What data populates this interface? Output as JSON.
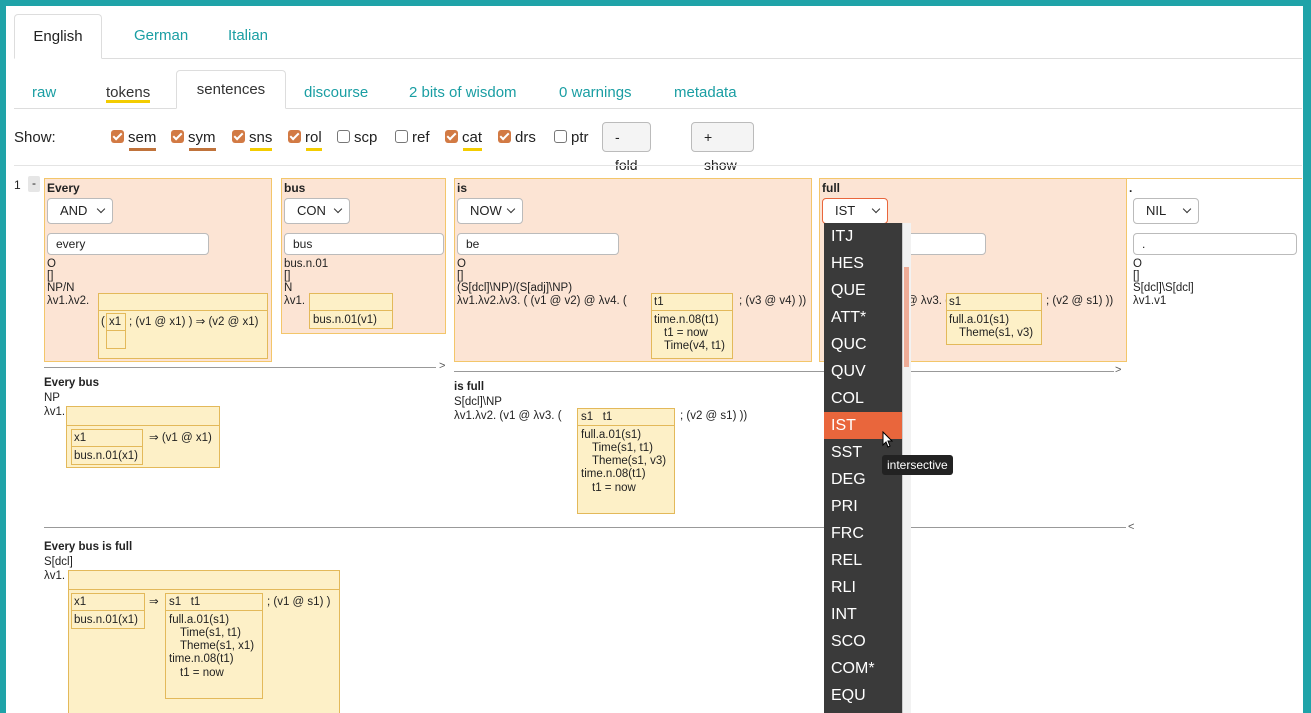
{
  "lang_tabs": [
    "English",
    "German",
    "Italian"
  ],
  "sub_tabs": [
    "raw",
    "tokens",
    "sentences",
    "discourse",
    "2 bits of wisdom",
    "0 warnings",
    "metadata"
  ],
  "show": {
    "label": "Show:",
    "layers": [
      {
        "name": "sem",
        "checked": true,
        "underline": "#c0733b"
      },
      {
        "name": "sym",
        "checked": true,
        "underline": "#c0733b"
      },
      {
        "name": "sns",
        "checked": true,
        "underline": "#f3cc00"
      },
      {
        "name": "rol",
        "checked": true,
        "underline": "#f3cc00"
      },
      {
        "name": "scp",
        "checked": false
      },
      {
        "name": "ref",
        "checked": false
      },
      {
        "name": "cat",
        "checked": true,
        "underline": "#f3cc00"
      },
      {
        "name": "drs",
        "checked": true
      },
      {
        "name": "ptr",
        "checked": false
      }
    ],
    "fold_all": "- fold all",
    "show_all": "+ show all layers"
  },
  "sentence_number": "1",
  "fold_marker": "-",
  "tokens": [
    {
      "word": "Every",
      "tag": "AND",
      "lemma": "every",
      "sym_o": "O",
      "brackets": "[]",
      "cat": "NP/N",
      "lambda": "λv1.λv2.",
      "drs_cond": "( x1 ; (v1 @ x1) ) ⇒ (v2 @ x1)",
      "drs_ref": "x1"
    },
    {
      "word": "bus",
      "tag": "CON",
      "lemma": "bus",
      "sense": "bus.n.01",
      "brackets": "[]",
      "cat": "N",
      "lambda": "λv1.",
      "cond": "bus.n.01(v1)"
    },
    {
      "word": "is",
      "tag": "NOW",
      "lemma": "be",
      "sym_o": "O",
      "brackets": "[]",
      "cat": "(S[dcl]\\NP)/(S[adj]\\NP)",
      "lambda": "λv1.λv2.λv3. ( (v1 @ v2) @ λv4. (",
      "ref": "t1",
      "after": "; (v3 @ v4) ))",
      "conds": [
        "time.n.08(t1)",
        "t1 = now",
        "Time(v4, t1)"
      ]
    },
    {
      "word": "full",
      "tag": "IST",
      "lambda": "@ λv3. (",
      "ref": "s1",
      "after": "; (v2 @ s1) ))",
      "conds": [
        "full.a.01(s1)",
        "Theme(s1, v3)"
      ]
    },
    {
      "word": ".",
      "tag": "NIL",
      "lemma": ".",
      "sym_o": "O",
      "brackets": "[]",
      "cat": "S[dcl]\\S[dcl]",
      "lambda": "λv1.v1"
    }
  ],
  "combos": [
    {
      "title": "Every bus",
      "cat": "NP",
      "lambda": "λv1.",
      "ref": "x1",
      "arrow": "⇒ (v1 @ x1)",
      "cond": "bus.n.01(x1)"
    },
    {
      "title": "is full",
      "cat": "S[dcl]\\NP",
      "lambda": "λv1.λv2. (v1 @ λv3. (",
      "refs": "s1   t1",
      "after": "; (v2 @ s1) ))",
      "conds": [
        "full.a.01(s1)",
        "Time(s1, t1)",
        "Theme(s1, v3)",
        "time.n.08(t1)",
        "t1 = now"
      ]
    },
    {
      "title": "Every bus is full",
      "cat": "S[dcl]",
      "lambda": "λv1.",
      "ref": "x1",
      "cond": "bus.n.01(x1)",
      "arrow": "⇒",
      "refs": "s1   t1",
      "after": "; (v1 @ s1) )",
      "conds": [
        "full.a.01(s1)",
        "Time(s1, t1)",
        "Theme(s1, x1)",
        "time.n.08(t1)",
        "t1 = now"
      ]
    }
  ],
  "arrows": [
    ">",
    ">",
    "<"
  ],
  "dropdown": {
    "options": [
      "ITJ",
      "HES",
      "QUE",
      "ATT*",
      "QUC",
      "QUV",
      "COL",
      "IST",
      "SST",
      "DEG",
      "PRI",
      "FRC",
      "REL",
      "RLI",
      "INT",
      "SCO",
      "COM*",
      "EQU"
    ],
    "highlighted": "IST",
    "tooltip": "intersective"
  },
  "colors": {
    "accent": "#1a9ea3",
    "token_bg": "#fce4d4",
    "drs_bg": "#fdf0c7",
    "highlight": "#e9663c",
    "sem_ul": "#c0733b",
    "sns_ul": "#f3cc00"
  }
}
